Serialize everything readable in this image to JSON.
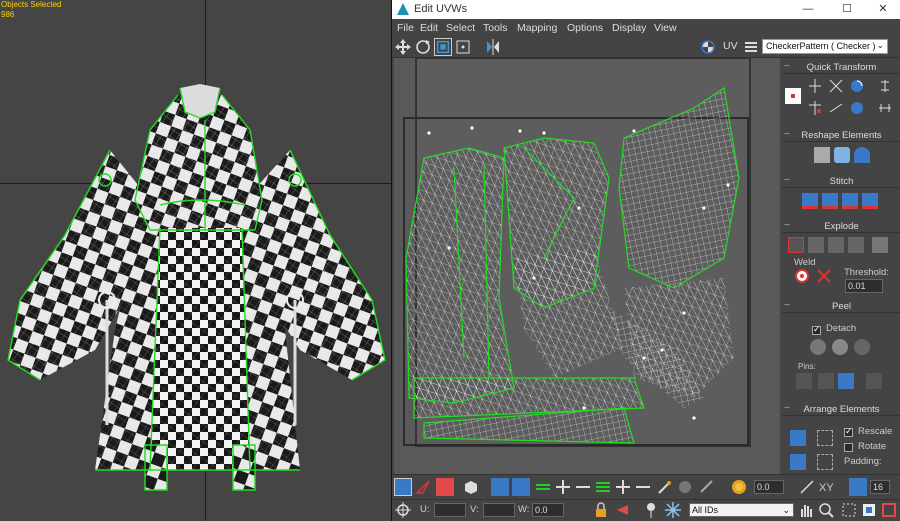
{
  "viewport": {
    "info_line1": "Objects Selected",
    "info_line2": "986"
  },
  "window": {
    "title": "Edit UVWs",
    "minimize": "—",
    "maximize": "☐",
    "close": "✕"
  },
  "menu": [
    "File",
    "Edit",
    "Select",
    "Tools",
    "Mapping",
    "Options",
    "Display",
    "View"
  ],
  "toolbar": {
    "uv_label": "UV",
    "texture_dropdown": "CheckerPattern  ( Checker )"
  },
  "rollouts": {
    "quick_transform": "Quick Transform",
    "reshape_elements": "Reshape Elements",
    "stitch": "Stitch",
    "explode": "Explode",
    "weld_label": "Weld",
    "threshold_label": "Threshold:",
    "threshold_value": "0.01",
    "peel": "Peel",
    "detach_label": "Detach",
    "pins_label": "Pins:",
    "arrange_elements": "Arrange Elements",
    "rescale_label": "Rescale",
    "rotate_label": "Rotate",
    "padding_label": "Padding:"
  },
  "bottom": {
    "field_value": "0.0",
    "xy_label": "XY",
    "number_value": "16",
    "u_label": "U:",
    "v_label": "V:",
    "w_label": "W:",
    "w_value": "0.0",
    "ids_dropdown": "All IDs"
  },
  "colors": {
    "selection_green": "#22dd22",
    "viewport_bg": "#454545",
    "uv_bg": "#595959",
    "accent_blue": "#3a78c8",
    "info_yellow": "#ffd200"
  }
}
